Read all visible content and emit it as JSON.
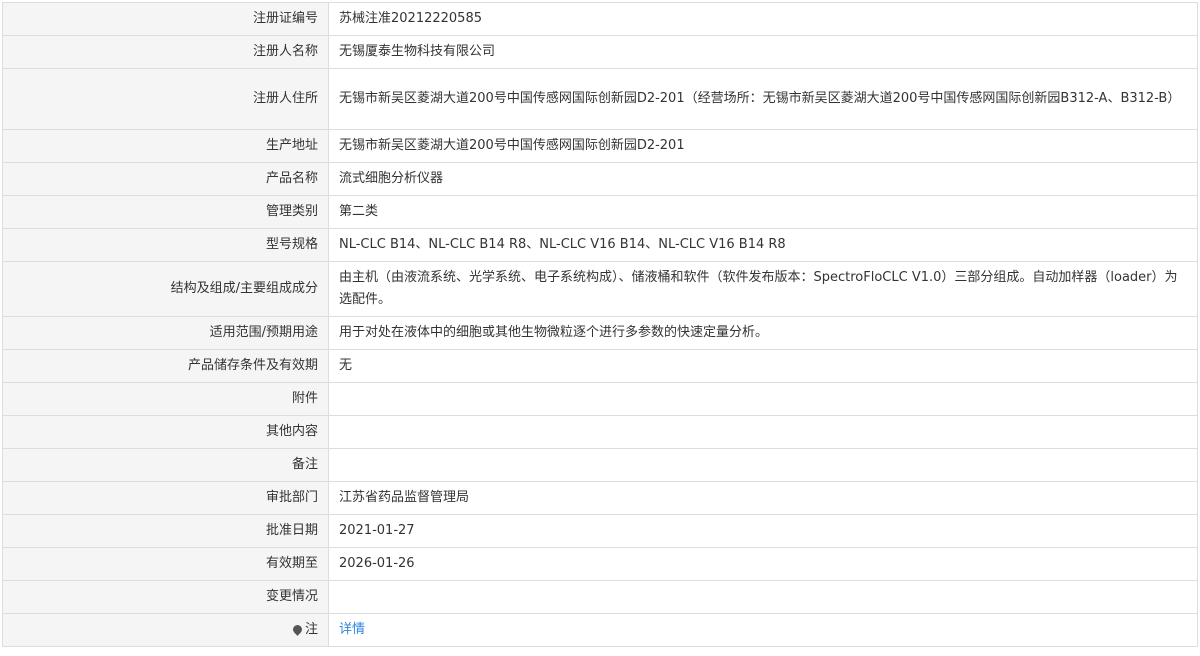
{
  "rows": [
    {
      "label": "注册证编号",
      "value": "苏械注准20212220585"
    },
    {
      "label": "注册人名称",
      "value": "无锡厦泰生物科技有限公司"
    },
    {
      "label": "注册人住所",
      "value": "无锡市新吴区菱湖大道200号中国传感网国际创新园D2-201（经营场所：无锡市新吴区菱湖大道200号中国传感网国际创新园B312-A、B312-B）"
    },
    {
      "label": "生产地址",
      "value": "无锡市新吴区菱湖大道200号中国传感网国际创新园D2-201"
    },
    {
      "label": "产品名称",
      "value": "流式细胞分析仪器"
    },
    {
      "label": "管理类别",
      "value": "第二类"
    },
    {
      "label": "型号规格",
      "value": "NL-CLC B14、NL-CLC B14 R8、NL-CLC V16 B14、NL-CLC V16 B14 R8"
    },
    {
      "label": "结构及组成/主要组成成分",
      "value": "由主机（由液流系统、光学系统、电子系统构成）、储液桶和软件（软件发布版本：SpectroFloCLC V1.0）三部分组成。自动加样器（loader）为选配件。"
    },
    {
      "label": "适用范围/预期用途",
      "value": "用于对处在液体中的细胞或其他生物微粒逐个进行多参数的快速定量分析。"
    },
    {
      "label": "产品储存条件及有效期",
      "value": "无"
    },
    {
      "label": "附件",
      "value": ""
    },
    {
      "label": "其他内容",
      "value": ""
    },
    {
      "label": "备注",
      "value": ""
    },
    {
      "label": "审批部门",
      "value": "江苏省药品监督管理局"
    },
    {
      "label": "批准日期",
      "value": "2021-01-27"
    },
    {
      "label": "有效期至",
      "value": "2026-01-26"
    },
    {
      "label": "变更情况",
      "value": ""
    }
  ],
  "note_row": {
    "label": "注",
    "icon": "map-pin-icon",
    "link_text": "详情"
  },
  "colors": {
    "label_bg": "#f5f5f5",
    "border": "#dddddd",
    "link": "#2a86e2"
  }
}
